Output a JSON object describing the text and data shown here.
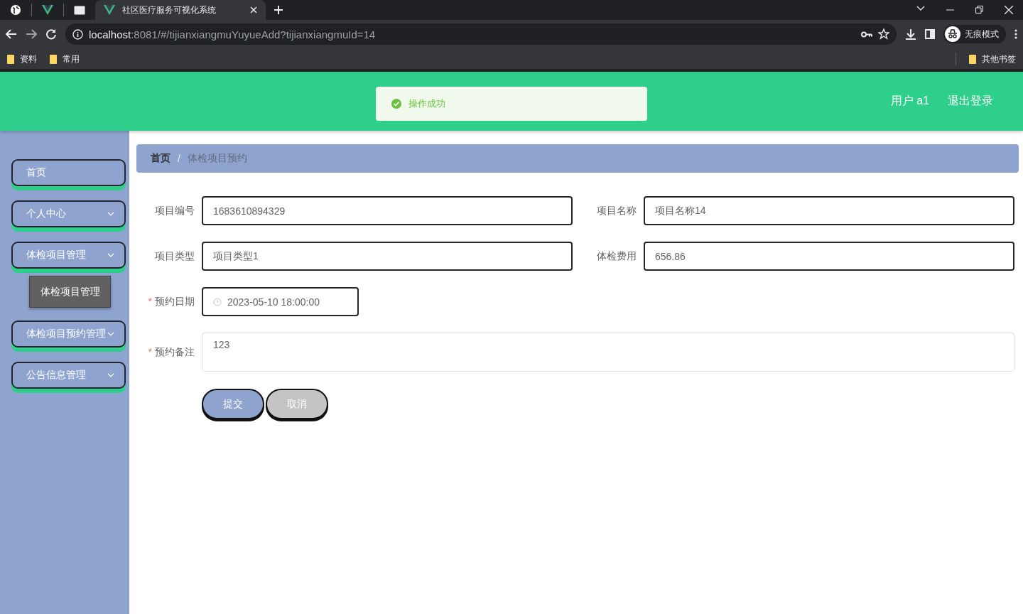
{
  "browser": {
    "tabs": [
      {
        "kind": "globe",
        "selected": false
      },
      {
        "kind": "vue",
        "selected": false
      },
      {
        "kind": "page",
        "selected": false
      },
      {
        "kind": "vue",
        "title": "社区医疗服务可视化系统",
        "selected": true
      }
    ],
    "url": {
      "host": "localhost",
      "path": ":8081/#/tijianxiangmuYuyueAdd?tijianxiangmuId=14"
    },
    "profile": "无痕模式",
    "bookmarks": [
      "资料",
      "常用"
    ],
    "other_bookmarks": "其他书签"
  },
  "header": {
    "toast": "操作成功",
    "user": "用户 a1",
    "logout": "退出登录"
  },
  "sidebar": {
    "items": [
      {
        "label": "首页",
        "kind": "link"
      },
      {
        "label": "个人中心",
        "kind": "submenu"
      },
      {
        "label": "体检项目管理",
        "kind": "submenu",
        "children": [
          {
            "label": "体检项目管理"
          }
        ]
      },
      {
        "label": "体检项目预约管理",
        "kind": "submenu"
      },
      {
        "label": "公告信息管理",
        "kind": "submenu"
      }
    ]
  },
  "breadcrumb": {
    "separator": "/",
    "items": [
      "首页",
      "体检项目预约"
    ]
  },
  "form": {
    "required_mark": "*",
    "fields": [
      {
        "label": "项目编号",
        "value": "1683610894329",
        "kind": "text",
        "required": false
      },
      {
        "label": "项目名称",
        "value": "项目名称14",
        "kind": "text",
        "required": false
      },
      {
        "label": "项目类型",
        "value": "项目类型1",
        "kind": "text",
        "required": false
      },
      {
        "label": "体检费用",
        "value": "656.86",
        "kind": "text",
        "required": false
      },
      {
        "label": "预约日期",
        "value": "2023-05-10 18:00:00",
        "kind": "date",
        "required": true
      },
      {
        "label": "预约备注",
        "value": "123",
        "kind": "textarea",
        "required": true
      }
    ],
    "buttons": [
      {
        "label": "提交",
        "kind": "primary"
      },
      {
        "label": "取消",
        "kind": "cancel"
      }
    ]
  }
}
